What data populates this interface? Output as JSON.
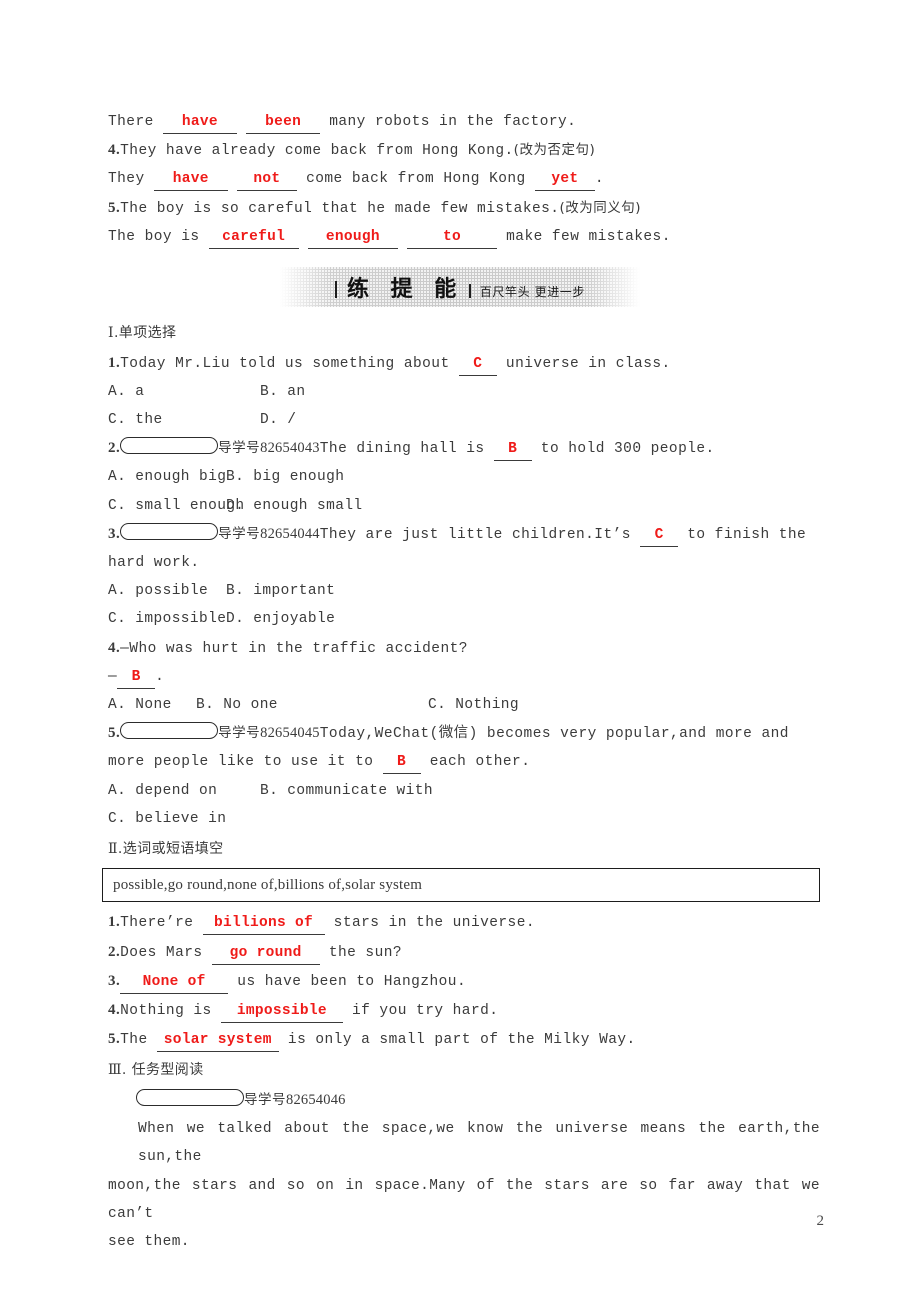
{
  "page": {
    "number": "2"
  },
  "top_exercises": {
    "line_a": {
      "pre": "There ",
      "blank1": "have",
      "blank2": "been",
      "post": " many robots in the factory."
    },
    "q4": {
      "num": "4.",
      "stem": "They have already come back from Hong Kong.",
      "instruction": "(改为否定句)",
      "answer_pre": "They ",
      "blank1": "have",
      "blank2": "not",
      "answer_mid": " come back from Hong Kong ",
      "blank3": "yet",
      "answer_post": "."
    },
    "q5": {
      "num": "5.",
      "stem": "The boy is so careful that he made few mistakes.",
      "instruction": "(改为同义句)",
      "answer_pre": "The boy is ",
      "blank1": "careful",
      "blank2": "enough",
      "blank3": "to",
      "answer_post": " make few mistakes."
    }
  },
  "banner": {
    "title": "练 提 能",
    "subtitle": "百尺竿头  更进一步"
  },
  "section1": {
    "heading_numeral": "Ⅰ",
    "heading_text": ".单项选择",
    "questions": [
      {
        "num": "1.",
        "badge": false,
        "daoxue_label": "",
        "serial": "",
        "text_before": "Today Mr.Liu told us something about ",
        "answer": "C",
        "text_after": " universe in class.",
        "options": [
          "A. a",
          "B. an",
          "C. the",
          "D. /"
        ]
      },
      {
        "num": "2.",
        "badge": true,
        "daoxue_label": "导学号",
        "serial": "82654043",
        "text_before": "The dining hall is ",
        "answer": "B",
        "text_after": " to hold 300 people.",
        "options": [
          "A. enough big",
          "B. big enough",
          "C. small enough",
          "D. enough small"
        ]
      },
      {
        "num": "3.",
        "badge": true,
        "daoxue_label": "导学号",
        "serial": "82654044",
        "text_before": "They are just little children.It’s ",
        "answer": "C",
        "text_after": " to finish the",
        "text_wrap": "hard work.",
        "options": [
          "A. possible",
          "B. important",
          "C. impossible",
          "D. enjoyable"
        ]
      },
      {
        "num": "4.",
        "badge": false,
        "daoxue_label": "",
        "serial": "",
        "text_before": "—Who was hurt in the traffic accident?",
        "answer": "B",
        "answer_line_pre": "—",
        "answer_line_post": ".",
        "options": [
          "A. None",
          "B. No one",
          "C. Nothing"
        ]
      },
      {
        "num": "5.",
        "badge": true,
        "daoxue_label": "导学号",
        "serial": "82654045",
        "text_before": "Today,WeChat(微信) becomes very popular,and more and",
        "text_wrap_pre": "more people like to use it to ",
        "answer": "B",
        "text_wrap_post": " each other.",
        "options": [
          "A. depend on",
          "B. communicate with",
          "C. believe in"
        ]
      }
    ]
  },
  "section2": {
    "heading_numeral": "Ⅱ",
    "heading_text": ".选词或短语填空",
    "wordbank": "possible,go round,none of,billions of,solar system",
    "items": [
      {
        "num": "1.",
        "pre": "There’re ",
        "answer": "billions of",
        "post": " stars in the universe."
      },
      {
        "num": "2.",
        "pre": "Does Mars ",
        "answer": "go round",
        "post": " the sun?"
      },
      {
        "num": "3.",
        "pre": "",
        "answer": "None of",
        "post": " us have been to Hangzhou."
      },
      {
        "num": "4.",
        "pre": "Nothing is ",
        "answer": "impossible",
        "post": " if you try hard."
      },
      {
        "num": "5.",
        "pre": "The ",
        "answer": "solar system",
        "post": " is only a small part of the Milky Way."
      }
    ]
  },
  "section3": {
    "heading_numeral": "Ⅲ",
    "heading_text": ". 任务型阅读",
    "daoxue_label": "导学号",
    "serial": "82654046",
    "passage_line1": "When we talked about the space,we know the universe means the earth,the sun,the",
    "passage_line2": "moon,the stars and so on in space.Many of the stars are so far away that we can’t",
    "passage_line3": "see them."
  }
}
